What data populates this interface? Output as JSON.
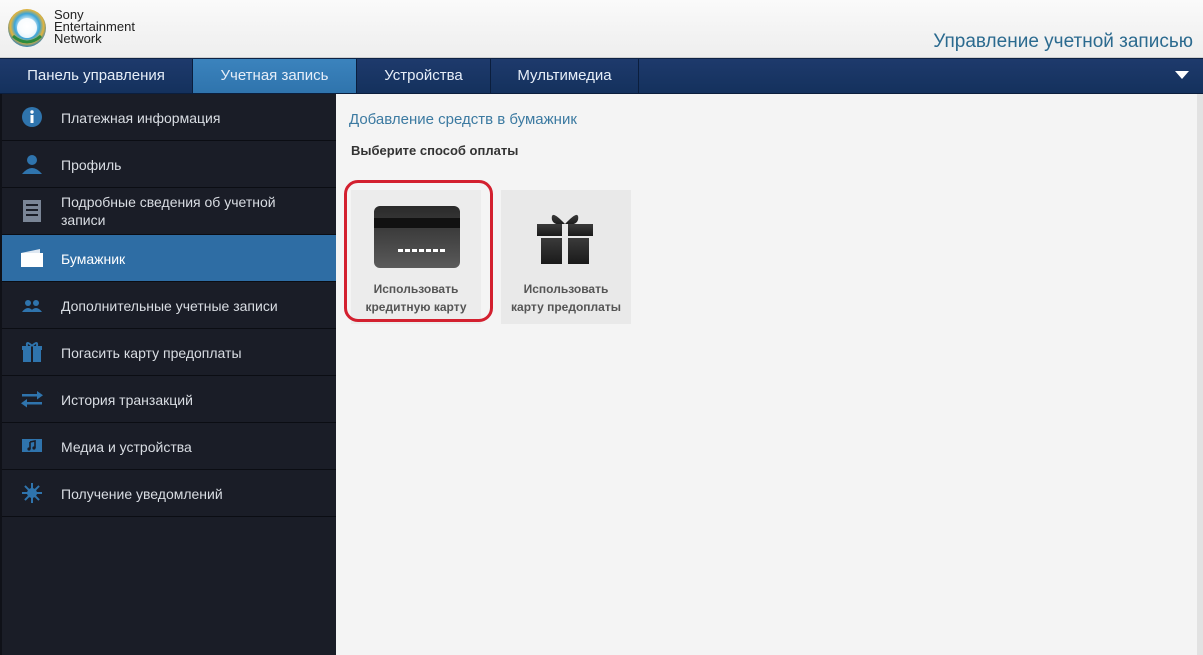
{
  "header": {
    "brand_lines": [
      "Sony",
      "Entertainment",
      "Network"
    ],
    "page_heading": "Управление учетной записью"
  },
  "nav": {
    "tabs": [
      {
        "label": "Панель управления",
        "active": false
      },
      {
        "label": "Учетная запись",
        "active": true
      },
      {
        "label": "Устройства",
        "active": false
      },
      {
        "label": "Мультимедиа",
        "active": false
      }
    ]
  },
  "sidebar": {
    "items": [
      {
        "label": "Платежная информация",
        "icon": "info-icon"
      },
      {
        "label": "Профиль",
        "icon": "person-icon"
      },
      {
        "label": "Подробные сведения об учетной записи",
        "icon": "document-icon"
      },
      {
        "label": "Бумажник",
        "icon": "wallet-icon",
        "active": true
      },
      {
        "label": "Дополнительные учетные записи",
        "icon": "people-icon"
      },
      {
        "label": "Погасить карту предоплаты",
        "icon": "gift-icon"
      },
      {
        "label": "История транзакций",
        "icon": "transfer-arrows-icon"
      },
      {
        "label": "Медиа и устройства",
        "icon": "media-icon"
      },
      {
        "label": "Получение уведомлений",
        "icon": "notification-icon"
      }
    ]
  },
  "content": {
    "title": "Добавление средств в бумажник",
    "subtitle": "Выберите способ оплаты",
    "options": [
      {
        "label_line1": "Использовать",
        "label_line2": "кредитную карту",
        "icon": "credit-card-icon"
      },
      {
        "label_line1": "Использовать",
        "label_line2": "карту предоплаты",
        "icon": "gift-box-icon"
      }
    ]
  },
  "colors": {
    "nav_bg": "#1e3a6c",
    "nav_active": "#3b83bd",
    "sidebar_bg": "#1a1d27",
    "sidebar_active": "#2e6da4",
    "heading_blue": "#2b6a8f",
    "highlight_red": "#d3202f"
  }
}
